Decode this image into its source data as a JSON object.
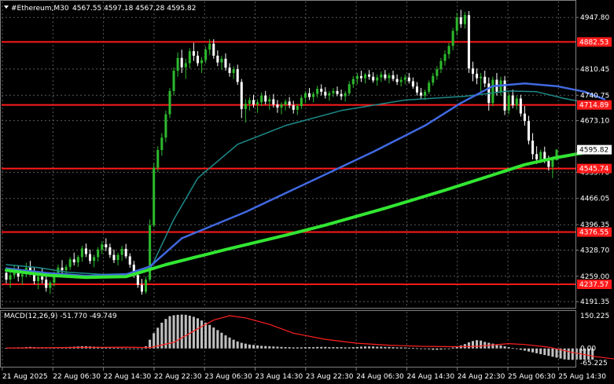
{
  "header": {
    "symbol": "#Ethereum,M30",
    "ohlc": "4567.55 4597.18 4567.28 4595.82"
  },
  "indicator": {
    "macd_label": "MACD(12,26,9) -51.770 -49.749"
  },
  "colors": {
    "background": "#000000",
    "grid": "#5a5a5a",
    "bull_candle": "#2db82d",
    "bear_candle": "#ffffff",
    "level_line": "#ff1a1a",
    "level_label_bg": "#ff1a1a",
    "ma_fast": "#1e8a8a",
    "ma_mid": "#4169e1",
    "ma_slow": "#32e632",
    "macd_hist": "#c0c0c0",
    "macd_signal": "#ff2020",
    "current_price_bg": "#ffffff"
  },
  "chart_data": {
    "type": "candlestick",
    "price_axis": {
      "ticks": [
        4947.8,
        4810.45,
        4740.75,
        4673.1,
        4535.7,
        4466.05,
        4396.35,
        4328.7,
        4259.0,
        4191.35
      ],
      "range": [
        4175,
        4990
      ]
    },
    "levels": [
      {
        "price": 4882.53,
        "label": "4882.53"
      },
      {
        "price": 4714.89,
        "label": "4714.89"
      },
      {
        "price": 4545.74,
        "label": "4545.74"
      },
      {
        "price": 4376.55,
        "label": "4376.55"
      },
      {
        "price": 4237.57,
        "label": "4237.57"
      }
    ],
    "current_price": {
      "price": 4595.82,
      "label": "4595.82"
    },
    "time_axis": [
      "21 Aug 2025",
      "22 Aug 06:30",
      "22 Aug 14:30",
      "22 Aug 22:30",
      "23 Aug 06:30",
      "23 Aug 14:30",
      "23 Aug 22:30",
      "24 Aug 06:30",
      "24 Aug 14:30",
      "24 Aug 22:30",
      "25 Aug 06:30",
      "25 Aug 14:30"
    ],
    "macd_axis": {
      "ticks": [
        150.225,
        0.0,
        -65.225
      ],
      "labels": [
        "150.225",
        "0.00",
        "-65.225"
      ],
      "range": [
        -80,
        168
      ]
    },
    "candles": [
      [
        4268,
        4283,
        4240,
        4250
      ],
      [
        4250,
        4270,
        4228,
        4262
      ],
      [
        4262,
        4290,
        4252,
        4275
      ],
      [
        4275,
        4286,
        4245,
        4258
      ],
      [
        4258,
        4276,
        4236,
        4264
      ],
      [
        4264,
        4295,
        4256,
        4282
      ],
      [
        4282,
        4300,
        4262,
        4270
      ],
      [
        4270,
        4282,
        4238,
        4246
      ],
      [
        4246,
        4268,
        4225,
        4258
      ],
      [
        4258,
        4280,
        4240,
        4250
      ],
      [
        4250,
        4262,
        4218,
        4228
      ],
      [
        4228,
        4248,
        4212,
        4242
      ],
      [
        4242,
        4272,
        4232,
        4266
      ],
      [
        4266,
        4290,
        4256,
        4282
      ],
      [
        4282,
        4302,
        4262,
        4275
      ],
      [
        4275,
        4290,
        4256,
        4284
      ],
      [
        4284,
        4310,
        4276,
        4304
      ],
      [
        4304,
        4322,
        4288,
        4296
      ],
      [
        4296,
        4315,
        4284,
        4310
      ],
      [
        4310,
        4340,
        4298,
        4333
      ],
      [
        4333,
        4346,
        4310,
        4318
      ],
      [
        4318,
        4330,
        4292,
        4300
      ],
      [
        4300,
        4316,
        4283,
        4310
      ],
      [
        4310,
        4336,
        4298,
        4330
      ],
      [
        4330,
        4352,
        4318,
        4344
      ],
      [
        4344,
        4360,
        4326,
        4336
      ],
      [
        4336,
        4346,
        4308,
        4316
      ],
      [
        4316,
        4330,
        4294,
        4302
      ],
      [
        4302,
        4322,
        4288,
        4316
      ],
      [
        4316,
        4340,
        4300,
        4332
      ],
      [
        4332,
        4345,
        4306,
        4312
      ],
      [
        4312,
        4320,
        4282,
        4290
      ],
      [
        4290,
        4300,
        4255,
        4262
      ],
      [
        4262,
        4270,
        4228,
        4236
      ],
      [
        4236,
        4252,
        4210,
        4218
      ],
      [
        4218,
        4258,
        4212,
        4250
      ],
      [
        4250,
        4410,
        4245,
        4395
      ],
      [
        4395,
        4560,
        4390,
        4548
      ],
      [
        4548,
        4605,
        4536,
        4595
      ],
      [
        4595,
        4640,
        4580,
        4628
      ],
      [
        4628,
        4700,
        4616,
        4690
      ],
      [
        4690,
        4760,
        4680,
        4752
      ],
      [
        4752,
        4815,
        4740,
        4806
      ],
      [
        4806,
        4855,
        4790,
        4840
      ],
      [
        4840,
        4862,
        4800,
        4815
      ],
      [
        4815,
        4838,
        4784,
        4826
      ],
      [
        4826,
        4866,
        4812,
        4858
      ],
      [
        4858,
        4880,
        4832,
        4846
      ],
      [
        4846,
        4858,
        4818,
        4826
      ],
      [
        4826,
        4842,
        4800,
        4834
      ],
      [
        4834,
        4870,
        4826,
        4862
      ],
      [
        4862,
        4890,
        4848,
        4878
      ],
      [
        4878,
        4890,
        4838,
        4846
      ],
      [
        4846,
        4860,
        4818,
        4828
      ],
      [
        4828,
        4846,
        4808,
        4838
      ],
      [
        4838,
        4852,
        4806,
        4814
      ],
      [
        4814,
        4826,
        4790,
        4800
      ],
      [
        4800,
        4818,
        4784,
        4810
      ],
      [
        4810,
        4822,
        4768,
        4776
      ],
      [
        4776,
        4784,
        4680,
        4704
      ],
      [
        4704,
        4730,
        4668,
        4718
      ],
      [
        4718,
        4736,
        4700,
        4728
      ],
      [
        4728,
        4742,
        4708,
        4716
      ],
      [
        4716,
        4730,
        4694,
        4722
      ],
      [
        4722,
        4748,
        4712,
        4740
      ],
      [
        4740,
        4752,
        4716,
        4724
      ],
      [
        4724,
        4738,
        4702,
        4730
      ],
      [
        4730,
        4744,
        4708,
        4716
      ],
      [
        4716,
        4728,
        4694,
        4708
      ],
      [
        4708,
        4722,
        4690,
        4716
      ],
      [
        4716,
        4730,
        4700,
        4724
      ],
      [
        4724,
        4736,
        4706,
        4714
      ],
      [
        4714,
        4726,
        4692,
        4702
      ],
      [
        4702,
        4718,
        4688,
        4712
      ],
      [
        4712,
        4740,
        4704,
        4734
      ],
      [
        4734,
        4752,
        4720,
        4746
      ],
      [
        4746,
        4760,
        4728,
        4736
      ],
      [
        4736,
        4750,
        4722,
        4744
      ],
      [
        4744,
        4766,
        4734,
        4758
      ],
      [
        4758,
        4770,
        4740,
        4750
      ],
      [
        4750,
        4762,
        4732,
        4740
      ],
      [
        4740,
        4752,
        4726,
        4746
      ],
      [
        4746,
        4760,
        4736,
        4752
      ],
      [
        4752,
        4764,
        4738,
        4744
      ],
      [
        4744,
        4756,
        4728,
        4738
      ],
      [
        4738,
        4752,
        4724,
        4746
      ],
      [
        4746,
        4778,
        4740,
        4770
      ],
      [
        4770,
        4792,
        4760,
        4784
      ],
      [
        4784,
        4800,
        4770,
        4792
      ],
      [
        4792,
        4806,
        4776,
        4786
      ],
      [
        4786,
        4800,
        4772,
        4796
      ],
      [
        4796,
        4808,
        4782,
        4790
      ],
      [
        4790,
        4802,
        4774,
        4780
      ],
      [
        4780,
        4796,
        4766,
        4788
      ],
      [
        4788,
        4804,
        4776,
        4796
      ],
      [
        4796,
        4808,
        4780,
        4786
      ],
      [
        4786,
        4800,
        4772,
        4794
      ],
      [
        4794,
        4806,
        4778,
        4784
      ],
      [
        4784,
        4796,
        4768,
        4776
      ],
      [
        4776,
        4790,
        4764,
        4782
      ],
      [
        4782,
        4796,
        4770,
        4788
      ],
      [
        4788,
        4800,
        4772,
        4778
      ],
      [
        4778,
        4788,
        4758,
        4764
      ],
      [
        4764,
        4776,
        4740,
        4748
      ],
      [
        4748,
        4760,
        4732,
        4740
      ],
      [
        4740,
        4756,
        4728,
        4750
      ],
      [
        4750,
        4780,
        4744,
        4774
      ],
      [
        4774,
        4800,
        4766,
        4792
      ],
      [
        4792,
        4818,
        4782,
        4810
      ],
      [
        4810,
        4840,
        4800,
        4832
      ],
      [
        4832,
        4860,
        4820,
        4850
      ],
      [
        4850,
        4880,
        4838,
        4872
      ],
      [
        4872,
        4920,
        4860,
        4912
      ],
      [
        4912,
        4960,
        4900,
        4948
      ],
      [
        4948,
        4968,
        4920,
        4930
      ],
      [
        4930,
        4962,
        4918,
        4954
      ],
      [
        4954,
        4965,
        4800,
        4812
      ],
      [
        4812,
        4830,
        4778,
        4798
      ],
      [
        4798,
        4812,
        4770,
        4786
      ],
      [
        4786,
        4800,
        4750,
        4790
      ],
      [
        4790,
        4806,
        4762,
        4772
      ],
      [
        4772,
        4788,
        4700,
        4720
      ],
      [
        4720,
        4790,
        4712,
        4782
      ],
      [
        4782,
        4800,
        4740,
        4750
      ],
      [
        4750,
        4790,
        4740,
        4780
      ],
      [
        4780,
        4792,
        4688,
        4700
      ],
      [
        4700,
        4748,
        4690,
        4740
      ],
      [
        4740,
        4756,
        4706,
        4714
      ],
      [
        4714,
        4740,
        4702,
        4732
      ],
      [
        4732,
        4742,
        4684,
        4692
      ],
      [
        4692,
        4712,
        4660,
        4672
      ],
      [
        4672,
        4686,
        4610,
        4620
      ],
      [
        4620,
        4640,
        4570,
        4584
      ],
      [
        4584,
        4605,
        4558,
        4570
      ],
      [
        4570,
        4596,
        4560,
        4590
      ],
      [
        4590,
        4604,
        4560,
        4566
      ],
      [
        4566,
        4580,
        4540,
        4550
      ],
      [
        4550,
        4578,
        4520,
        4572
      ],
      [
        4567.55,
        4597.18,
        4567.28,
        4595.82
      ]
    ],
    "series": [
      {
        "name": "",
        "values": [
          [
            0,
            4290
          ],
          [
            8,
            4282
          ],
          [
            15,
            4270
          ],
          [
            24,
            4264
          ],
          [
            32,
            4266
          ],
          [
            36,
            4275
          ],
          [
            42,
            4410
          ],
          [
            48,
            4520
          ],
          [
            58,
            4610
          ],
          [
            70,
            4660
          ],
          [
            84,
            4700
          ],
          [
            100,
            4728
          ],
          [
            115,
            4738
          ],
          [
            126,
            4752
          ],
          [
            133,
            4750
          ],
          [
            140,
            4732
          ],
          [
            150,
            4712
          ]
        ]
      },
      {
        "name": "",
        "values": [
          [
            0,
            4280
          ],
          [
            10,
            4268
          ],
          [
            20,
            4260
          ],
          [
            30,
            4264
          ],
          [
            36,
            4285
          ],
          [
            44,
            4360
          ],
          [
            60,
            4430
          ],
          [
            76,
            4510
          ],
          [
            92,
            4590
          ],
          [
            105,
            4660
          ],
          [
            114,
            4720
          ],
          [
            122,
            4765
          ],
          [
            130,
            4772
          ],
          [
            138,
            4765
          ],
          [
            145,
            4750
          ],
          [
            150,
            4730
          ]
        ]
      },
      {
        "name": "",
        "values": [
          [
            0,
            4275
          ],
          [
            10,
            4262
          ],
          [
            20,
            4256
          ],
          [
            30,
            4258
          ],
          [
            40,
            4290
          ],
          [
            55,
            4330
          ],
          [
            70,
            4368
          ],
          [
            80,
            4395
          ],
          [
            95,
            4440
          ],
          [
            110,
            4488
          ],
          [
            120,
            4522
          ],
          [
            130,
            4556
          ],
          [
            138,
            4575
          ],
          [
            145,
            4588
          ],
          [
            150,
            4598
          ]
        ]
      }
    ],
    "macd": {
      "histogram": [
        2,
        3,
        4,
        5,
        5,
        6,
        7,
        6,
        5,
        5,
        4,
        3,
        3,
        4,
        5,
        6,
        7,
        8,
        9,
        10,
        10,
        9,
        8,
        7,
        6,
        5,
        4,
        3,
        2,
        1,
        0,
        -1,
        -2,
        -2,
        -3,
        10,
        40,
        70,
        95,
        118,
        135,
        148,
        152,
        154,
        155,
        154,
        150,
        145,
        138,
        128,
        118,
        108,
        96,
        84,
        72,
        60,
        50,
        40,
        32,
        26,
        22,
        18,
        16,
        14,
        12,
        11,
        10,
        9,
        8,
        7,
        6,
        6,
        5,
        5,
        5,
        6,
        6,
        6,
        7,
        7,
        7,
        6,
        6,
        6,
        6,
        5,
        5,
        6,
        7,
        8,
        9,
        9,
        9,
        8,
        8,
        7,
        7,
        6,
        5,
        5,
        4,
        3,
        2,
        1,
        0,
        -2,
        -4,
        -6,
        -6,
        -5,
        -3,
        0,
        4,
        8,
        14,
        20,
        28,
        34,
        38,
        36,
        30,
        26,
        22,
        18,
        14,
        10,
        6,
        2,
        -2,
        -6,
        -10,
        -14,
        -18,
        -22,
        -26,
        -30,
        -34,
        -38,
        -42,
        -46,
        -50,
        -52,
        -52,
        -51,
        -51,
        -51,
        -51,
        -51
      ],
      "signal": [
        [
          0,
          2
        ],
        [
          20,
          5
        ],
        [
          30,
          6
        ],
        [
          36,
          4
        ],
        [
          42,
          28
        ],
        [
          48,
          90
        ],
        [
          52,
          130
        ],
        [
          56,
          150
        ],
        [
          60,
          140
        ],
        [
          66,
          110
        ],
        [
          72,
          70
        ],
        [
          80,
          42
        ],
        [
          88,
          24
        ],
        [
          96,
          15
        ],
        [
          104,
          10
        ],
        [
          112,
          8
        ],
        [
          118,
          10
        ],
        [
          122,
          16
        ],
        [
          126,
          22
        ],
        [
          130,
          18
        ],
        [
          136,
          6
        ],
        [
          142,
          -18
        ],
        [
          148,
          -38
        ],
        [
          152,
          -47
        ],
        [
          155,
          -49.749
        ]
      ]
    }
  }
}
